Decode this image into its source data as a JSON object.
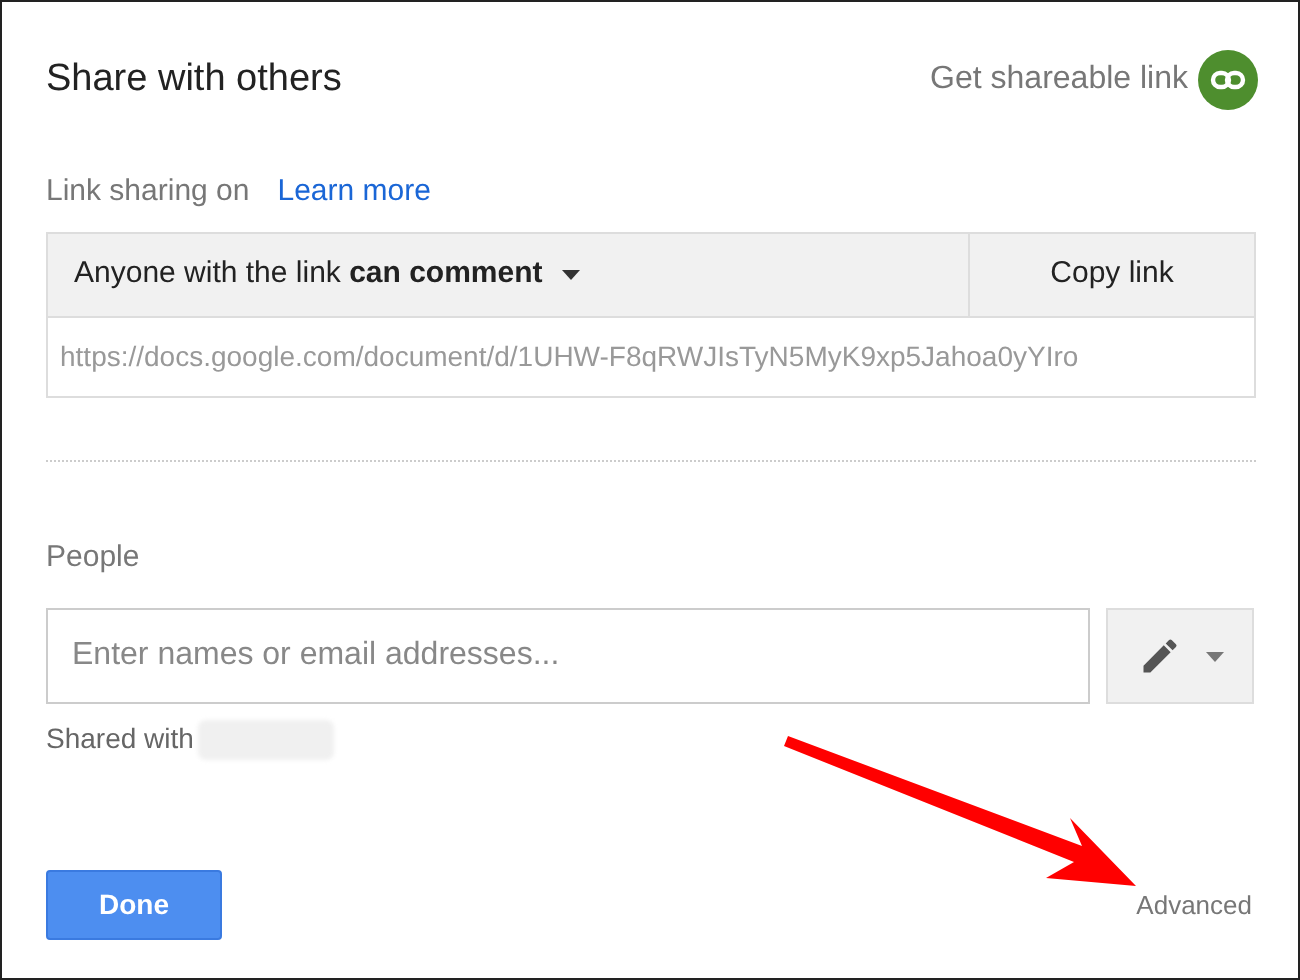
{
  "dialog": {
    "title": "Share with others",
    "shareable_link": "Get shareable link"
  },
  "link_sharing": {
    "label": "Link sharing on",
    "learn_more": "Learn more",
    "access": "Anyone with the link **can comment**",
    "copy_button": "Copy link",
    "url": "https://docs.google.com/document/d/1UHW-F8qRWJIsTyN5MyK9xp5Jahoa0yYIro"
  },
  "people": {
    "label": "People",
    "placeholder": "Enter names or email addresses...",
    "shared_with": "Shared with"
  },
  "buttons": {
    "done": "Done",
    "advanced": "Advanced"
  }
}
